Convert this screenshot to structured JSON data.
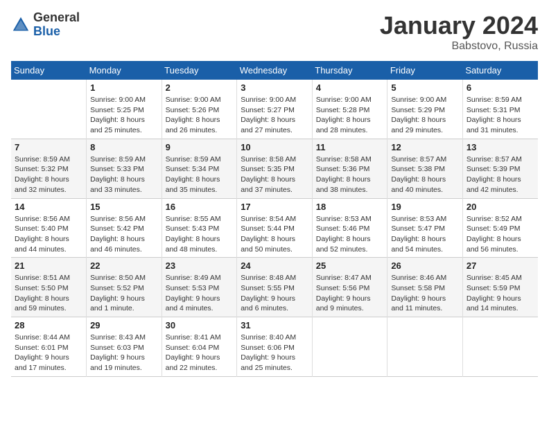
{
  "logo": {
    "general": "General",
    "blue": "Blue"
  },
  "title": "January 2024",
  "subtitle": "Babstovo, Russia",
  "days_header": [
    "Sunday",
    "Monday",
    "Tuesday",
    "Wednesday",
    "Thursday",
    "Friday",
    "Saturday"
  ],
  "weeks": [
    [
      {
        "day": "",
        "info": ""
      },
      {
        "day": "1",
        "info": "Sunrise: 9:00 AM\nSunset: 5:25 PM\nDaylight: 8 hours\nand 25 minutes."
      },
      {
        "day": "2",
        "info": "Sunrise: 9:00 AM\nSunset: 5:26 PM\nDaylight: 8 hours\nand 26 minutes."
      },
      {
        "day": "3",
        "info": "Sunrise: 9:00 AM\nSunset: 5:27 PM\nDaylight: 8 hours\nand 27 minutes."
      },
      {
        "day": "4",
        "info": "Sunrise: 9:00 AM\nSunset: 5:28 PM\nDaylight: 8 hours\nand 28 minutes."
      },
      {
        "day": "5",
        "info": "Sunrise: 9:00 AM\nSunset: 5:29 PM\nDaylight: 8 hours\nand 29 minutes."
      },
      {
        "day": "6",
        "info": "Sunrise: 8:59 AM\nSunset: 5:31 PM\nDaylight: 8 hours\nand 31 minutes."
      }
    ],
    [
      {
        "day": "7",
        "info": "Sunrise: 8:59 AM\nSunset: 5:32 PM\nDaylight: 8 hours\nand 32 minutes."
      },
      {
        "day": "8",
        "info": "Sunrise: 8:59 AM\nSunset: 5:33 PM\nDaylight: 8 hours\nand 33 minutes."
      },
      {
        "day": "9",
        "info": "Sunrise: 8:59 AM\nSunset: 5:34 PM\nDaylight: 8 hours\nand 35 minutes."
      },
      {
        "day": "10",
        "info": "Sunrise: 8:58 AM\nSunset: 5:35 PM\nDaylight: 8 hours\nand 37 minutes."
      },
      {
        "day": "11",
        "info": "Sunrise: 8:58 AM\nSunset: 5:36 PM\nDaylight: 8 hours\nand 38 minutes."
      },
      {
        "day": "12",
        "info": "Sunrise: 8:57 AM\nSunset: 5:38 PM\nDaylight: 8 hours\nand 40 minutes."
      },
      {
        "day": "13",
        "info": "Sunrise: 8:57 AM\nSunset: 5:39 PM\nDaylight: 8 hours\nand 42 minutes."
      }
    ],
    [
      {
        "day": "14",
        "info": "Sunrise: 8:56 AM\nSunset: 5:40 PM\nDaylight: 8 hours\nand 44 minutes."
      },
      {
        "day": "15",
        "info": "Sunrise: 8:56 AM\nSunset: 5:42 PM\nDaylight: 8 hours\nand 46 minutes."
      },
      {
        "day": "16",
        "info": "Sunrise: 8:55 AM\nSunset: 5:43 PM\nDaylight: 8 hours\nand 48 minutes."
      },
      {
        "day": "17",
        "info": "Sunrise: 8:54 AM\nSunset: 5:44 PM\nDaylight: 8 hours\nand 50 minutes."
      },
      {
        "day": "18",
        "info": "Sunrise: 8:53 AM\nSunset: 5:46 PM\nDaylight: 8 hours\nand 52 minutes."
      },
      {
        "day": "19",
        "info": "Sunrise: 8:53 AM\nSunset: 5:47 PM\nDaylight: 8 hours\nand 54 minutes."
      },
      {
        "day": "20",
        "info": "Sunrise: 8:52 AM\nSunset: 5:49 PM\nDaylight: 8 hours\nand 56 minutes."
      }
    ],
    [
      {
        "day": "21",
        "info": "Sunrise: 8:51 AM\nSunset: 5:50 PM\nDaylight: 8 hours\nand 59 minutes."
      },
      {
        "day": "22",
        "info": "Sunrise: 8:50 AM\nSunset: 5:52 PM\nDaylight: 9 hours\nand 1 minute."
      },
      {
        "day": "23",
        "info": "Sunrise: 8:49 AM\nSunset: 5:53 PM\nDaylight: 9 hours\nand 4 minutes."
      },
      {
        "day": "24",
        "info": "Sunrise: 8:48 AM\nSunset: 5:55 PM\nDaylight: 9 hours\nand 6 minutes."
      },
      {
        "day": "25",
        "info": "Sunrise: 8:47 AM\nSunset: 5:56 PM\nDaylight: 9 hours\nand 9 minutes."
      },
      {
        "day": "26",
        "info": "Sunrise: 8:46 AM\nSunset: 5:58 PM\nDaylight: 9 hours\nand 11 minutes."
      },
      {
        "day": "27",
        "info": "Sunrise: 8:45 AM\nSunset: 5:59 PM\nDaylight: 9 hours\nand 14 minutes."
      }
    ],
    [
      {
        "day": "28",
        "info": "Sunrise: 8:44 AM\nSunset: 6:01 PM\nDaylight: 9 hours\nand 17 minutes."
      },
      {
        "day": "29",
        "info": "Sunrise: 8:43 AM\nSunset: 6:03 PM\nDaylight: 9 hours\nand 19 minutes."
      },
      {
        "day": "30",
        "info": "Sunrise: 8:41 AM\nSunset: 6:04 PM\nDaylight: 9 hours\nand 22 minutes."
      },
      {
        "day": "31",
        "info": "Sunrise: 8:40 AM\nSunset: 6:06 PM\nDaylight: 9 hours\nand 25 minutes."
      },
      {
        "day": "",
        "info": ""
      },
      {
        "day": "",
        "info": ""
      },
      {
        "day": "",
        "info": ""
      }
    ]
  ]
}
